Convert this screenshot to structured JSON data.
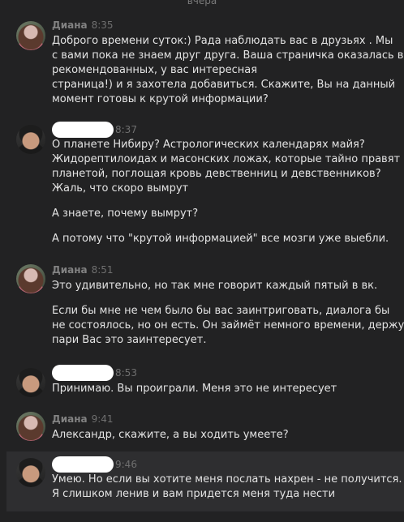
{
  "date_separator": "вчера",
  "messages": [
    {
      "author": "Диана",
      "time": "8:35",
      "lines": [
        "Доброго времени суток:) Рада наблюдать вас в друзьях . Мы",
        "с вами пока не знаем друг друга. Ваша страничка оказалась в",
        "рекомендованных, у вас интересная",
        "страница!) и я захотела добавиться. Скажите, Вы на данный",
        "момент готовы к крутой информации?"
      ]
    },
    {
      "author": "",
      "time": "8:37",
      "lines": [
        "О планете Нибиру? Астрологических календарях майя?",
        "Жидорептилоидах и масонских ложах, которые тайно правят",
        "планетой, поглощая кровь девственниц и девственников?",
        "Жаль, что скоро вымрут",
        "А знаете, почему вымрут?",
        "А потому что \"крутой информацией\" все мозги уже выебли."
      ]
    },
    {
      "author": "Диана",
      "time": "8:51",
      "lines": [
        "Это удивительно, но так мне говорит каждый пятый в вк.",
        "Если бы мне не чем было бы вас заинтриговать, диалога бы",
        "не состоялось, но он есть. Он займёт немного времени, держу",
        "пари Вас это заинтересует."
      ]
    },
    {
      "author": "",
      "time": "8:53",
      "lines": [
        "Принимаю. Вы проиграли. Меня это не интересует"
      ]
    },
    {
      "author": "Диана",
      "time": "9:41",
      "lines": [
        "Александр, скажите, а вы ходить умеете?"
      ]
    },
    {
      "author": "",
      "time": "9:46",
      "lines": [
        "Умею. Но если вы хотите меня послать нахрен - не получится.",
        "Я слишком ленив и вам придется меня туда нести"
      ]
    }
  ]
}
